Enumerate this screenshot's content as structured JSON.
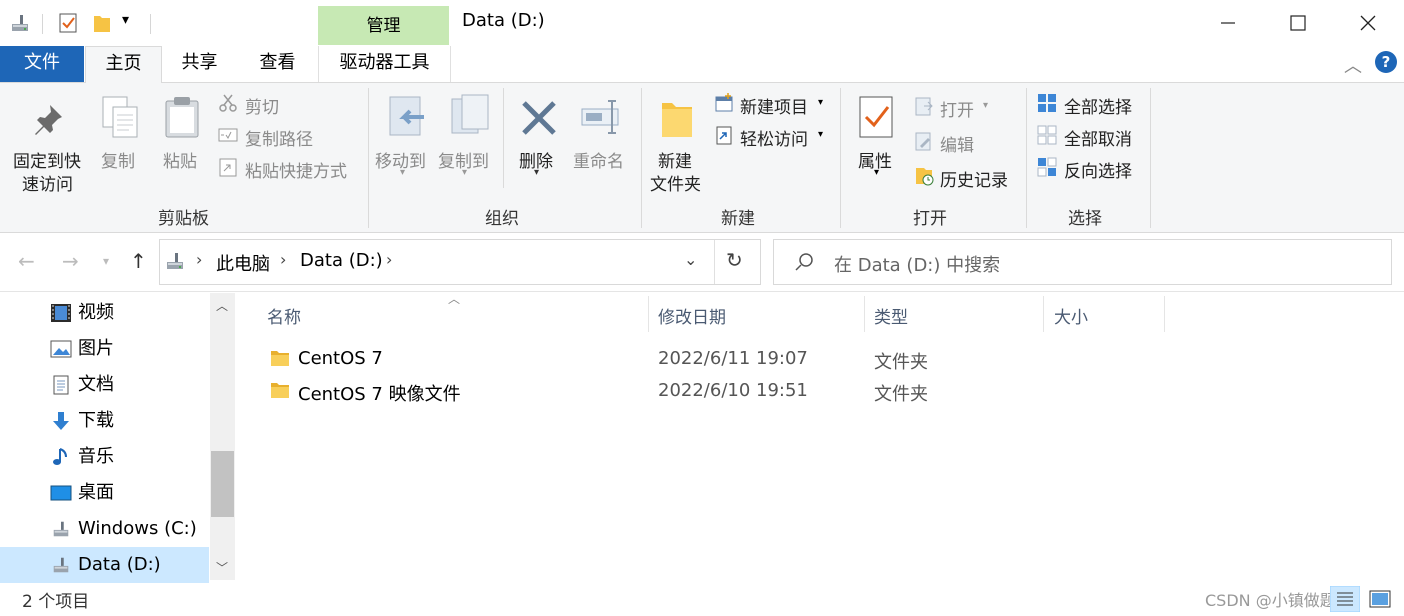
{
  "window": {
    "title": "Data (D:)",
    "context_tab_header": "管理",
    "controls": {
      "minimize": "—",
      "maximize": "☐",
      "close": "✕"
    }
  },
  "tabs": {
    "file": "文件",
    "home": "主页",
    "share": "共享",
    "view": "查看",
    "drive_tools": "驱动器工具"
  },
  "ribbon": {
    "clipboard": {
      "group_label": "剪贴板",
      "pin_quick_access": [
        "固定到快",
        "速访问"
      ],
      "copy": "复制",
      "paste": "粘贴",
      "cut": "剪切",
      "copy_path": "复制路径",
      "paste_shortcut": "粘贴快捷方式"
    },
    "organize": {
      "group_label": "组织",
      "move_to": "移动到",
      "copy_to": "复制到",
      "delete": "删除",
      "rename": "重命名"
    },
    "new": {
      "group_label": "新建",
      "new_folder": [
        "新建",
        "文件夹"
      ],
      "new_item": "新建项目",
      "easy_access": "轻松访问"
    },
    "open": {
      "group_label": "打开",
      "properties": "属性",
      "open": "打开",
      "edit": "编辑",
      "history": "历史记录"
    },
    "select": {
      "group_label": "选择",
      "select_all": "全部选择",
      "select_none": "全部取消",
      "invert_selection": "反向选择"
    }
  },
  "address": {
    "crumbs": [
      "此电脑",
      "Data (D:)"
    ],
    "search_placeholder": "在 Data (D:) 中搜索"
  },
  "nav_pane": {
    "items": [
      {
        "label": "视频",
        "icon": "video-icon"
      },
      {
        "label": "图片",
        "icon": "pictures-icon"
      },
      {
        "label": "文档",
        "icon": "documents-icon"
      },
      {
        "label": "下载",
        "icon": "download-icon"
      },
      {
        "label": "音乐",
        "icon": "music-icon"
      },
      {
        "label": "桌面",
        "icon": "desktop-icon"
      },
      {
        "label": "Windows (C:)",
        "icon": "drive-icon"
      },
      {
        "label": "Data (D:)",
        "icon": "drive-icon",
        "selected": true
      }
    ]
  },
  "file_list": {
    "columns": [
      "名称",
      "修改日期",
      "类型",
      "大小"
    ],
    "rows": [
      {
        "name": "CentOS 7",
        "modified": "2022/6/11 19:07",
        "type": "文件夹",
        "size": ""
      },
      {
        "name": "CentOS 7 映像文件",
        "modified": "2022/6/10 19:51",
        "type": "文件夹",
        "size": ""
      }
    ]
  },
  "status": {
    "item_count": "2 个项目",
    "watermark": "CSDN @小镇做题家"
  },
  "colors": {
    "file_tab": "#1e66b7",
    "context_tab": "#c7e9b4",
    "selection": "#cce8ff",
    "folder": "#f6c344"
  }
}
